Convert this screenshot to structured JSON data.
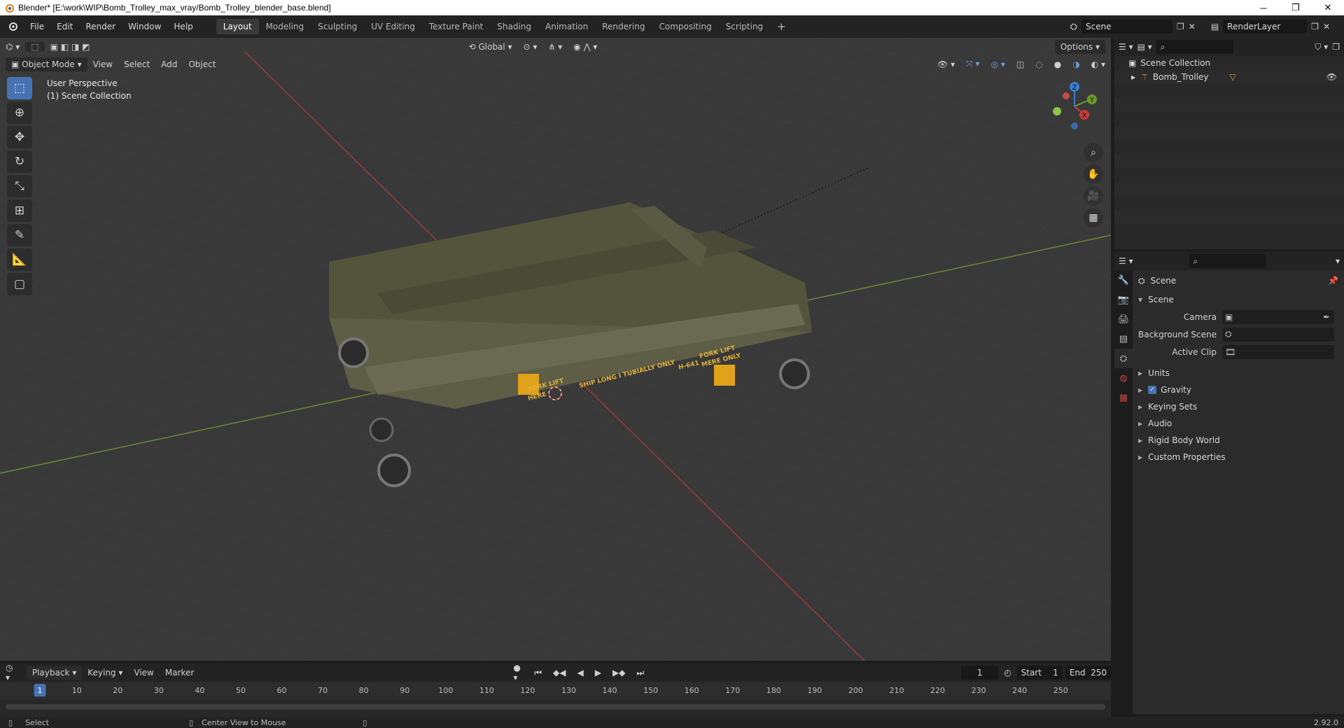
{
  "window": {
    "title": "Blender* [E:\\work\\WIP\\Bomb_Trolley_max_vray/Bomb_Trolley_blender_base.blend]",
    "minimize": "─",
    "restore": "❐",
    "close": "✕"
  },
  "menu": [
    "File",
    "Edit",
    "Render",
    "Window",
    "Help"
  ],
  "workspaces": [
    "Layout",
    "Modeling",
    "Sculpting",
    "UV Editing",
    "Texture Paint",
    "Shading",
    "Animation",
    "Rendering",
    "Compositing",
    "Scripting"
  ],
  "active_workspace": "Layout",
  "add_workspace": "+",
  "scene_field": "Scene",
  "renderlayer_field": "RenderLayer",
  "viewport": {
    "orientation": "Global",
    "options": "Options",
    "mode": "Object Mode",
    "menus": [
      "View",
      "Select",
      "Add",
      "Object"
    ],
    "perspective": "User Perspective",
    "collection": "(1) Scene Collection",
    "gizmo": {
      "x": "X",
      "y": "Y",
      "z": "Z"
    },
    "model_labels": [
      "FORK LIFT",
      "FORK LIFT",
      "SHIP LONG I TUBIALLY ONLY",
      "HERE",
      "MERE ONLY",
      "H-641"
    ]
  },
  "outliner": {
    "root": "Scene Collection",
    "items": [
      {
        "label": "Bomb_Trolley"
      }
    ]
  },
  "properties": {
    "context": "Scene",
    "panel": "Scene",
    "fields": [
      {
        "label": "Camera",
        "value": ""
      },
      {
        "label": "Background Scene",
        "value": ""
      },
      {
        "label": "Active Clip",
        "value": ""
      }
    ],
    "sections": [
      "Units",
      "Gravity",
      "Keying Sets",
      "Audio",
      "Rigid Body World",
      "Custom Properties"
    ],
    "gravity_checked": true
  },
  "timeline": {
    "menus": [
      "Playback",
      "Keying",
      "View",
      "Marker"
    ],
    "current_frame": "1",
    "start_label": "Start",
    "start": "1",
    "end_label": "End",
    "end": "250",
    "ruler": [
      "1",
      "10",
      "20",
      "30",
      "40",
      "50",
      "60",
      "70",
      "80",
      "90",
      "100",
      "110",
      "120",
      "130",
      "140",
      "150",
      "160",
      "170",
      "180",
      "190",
      "200",
      "210",
      "220",
      "230",
      "240",
      "250"
    ]
  },
  "status": {
    "select": "Select",
    "center": "Center View to Mouse",
    "version": "2.92.0"
  }
}
